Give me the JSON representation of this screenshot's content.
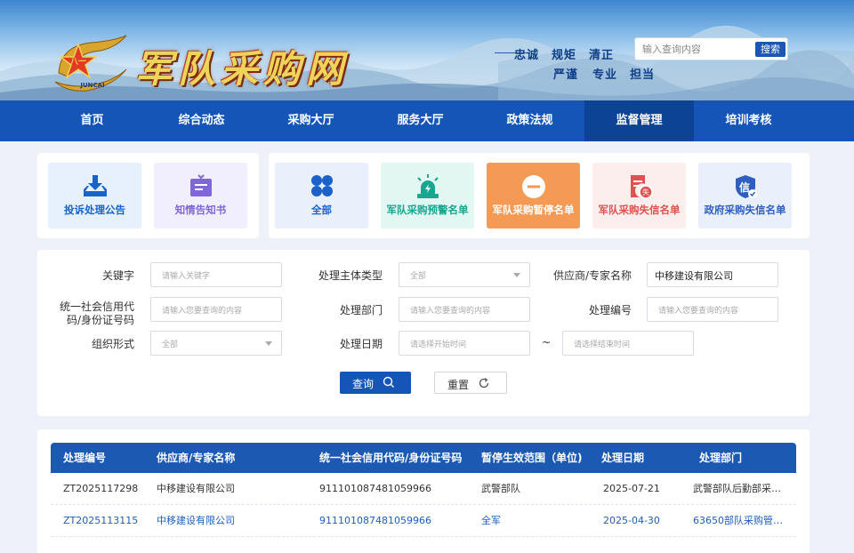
{
  "header": {
    "site_title": "军队采购网",
    "slogans": [
      "忠诚",
      "规矩",
      "清正",
      "严谨",
      "专业",
      "担当"
    ],
    "search": {
      "placeholder": "输入查询内容",
      "button": "搜索"
    }
  },
  "nav": {
    "items": [
      {
        "label": "首页"
      },
      {
        "label": "综合动态"
      },
      {
        "label": "采购大厅"
      },
      {
        "label": "服务大厅"
      },
      {
        "label": "政策法规"
      },
      {
        "label": "监督管理"
      },
      {
        "label": "培训考核"
      }
    ],
    "active_index": 5
  },
  "left_tiles": [
    {
      "label": "投诉处理公告",
      "icon": "download-tray-icon",
      "color": "#1a62c8"
    },
    {
      "label": "知情告知书",
      "icon": "message-box-icon",
      "color": "#8067d6"
    }
  ],
  "right_tiles": [
    {
      "label": "全部",
      "icon": "grid-four-icon",
      "color": "#1a62c8"
    },
    {
      "label": "军队采购预警名单",
      "icon": "alarm-siren-icon",
      "color": "#17a68f"
    },
    {
      "label": "军队采购暂停名单",
      "icon": "pause-circle-icon",
      "color": "#ffffff",
      "active": true
    },
    {
      "label": "军队采购失信名单",
      "icon": "document-badge-icon",
      "color": "#e0524f"
    },
    {
      "label": "政府采购失信名单",
      "icon": "shield-credit-icon",
      "color": "#2e5fbf"
    }
  ],
  "filters": {
    "keyword": {
      "label": "关键字",
      "placeholder": "请输入关键字"
    },
    "subject_type": {
      "label": "处理主体类型",
      "value": "全部"
    },
    "supplier_name": {
      "label": "供应商/专家名称",
      "value": "中移建设有限公司"
    },
    "credit_code": {
      "label_line1": "统一社会信用代",
      "label_line2": "码/身份证号码",
      "placeholder": "请输入您要查询的内容"
    },
    "department": {
      "label": "处理部门",
      "placeholder": "请输入您要查询的内容"
    },
    "number": {
      "label": "处理编号",
      "placeholder": "请输入您要查询的内容"
    },
    "org_form": {
      "label": "组织形式",
      "value": "全部"
    },
    "date": {
      "label": "处理日期",
      "start_placeholder": "请选择开始时间",
      "separator": "~",
      "end_placeholder": "请选择结束时间"
    },
    "query_button": "查询",
    "reset_button": "重置"
  },
  "table": {
    "columns": [
      "处理编号",
      "供应商/专家名称",
      "统一社会信用代码/身份证号码",
      "暂停生效范围（单位)",
      "处理日期",
      "处理部门"
    ],
    "rows": [
      {
        "id": "ZT2025117298",
        "name": "中移建设有限公司",
        "code": "911101087481059966",
        "scope": "武警部队",
        "date": "2025-07-21",
        "dept": "武警部队后勤部采购...",
        "highlight": false
      },
      {
        "id": "ZT2025113115",
        "name": "中移建设有限公司",
        "code": "911101087481059966",
        "scope": "全军",
        "date": "2025-04-30",
        "dept": "63650部队采购管理...",
        "highlight": true
      }
    ]
  },
  "colors": {
    "primary": "#1555b7",
    "nav_active": "#0d4395",
    "link_blue": "#1a5fc0",
    "active_tile": "#f59a54"
  }
}
